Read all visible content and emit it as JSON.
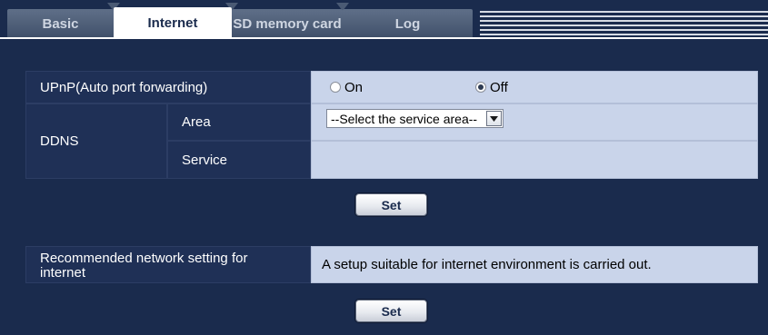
{
  "tabs": [
    {
      "label": "Basic",
      "active": false
    },
    {
      "label": "Internet",
      "active": true
    },
    {
      "label": "SD memory card",
      "active": false
    },
    {
      "label": "Log",
      "active": false
    }
  ],
  "upnp": {
    "label": "UPnP(Auto port forwarding)",
    "options": [
      {
        "label": "On",
        "checked": false
      },
      {
        "label": "Off",
        "checked": true
      }
    ]
  },
  "ddns": {
    "label": "DDNS",
    "area_label": "Area",
    "area_value": "--Select the service area--",
    "service_label": "Service",
    "service_value": ""
  },
  "set_button_1": "Set",
  "recommended": {
    "label": "Recommended network setting for internet",
    "description": "A setup suitable for internet environment is carried out."
  },
  "set_button_2": "Set",
  "colors": {
    "background": "#1a2b4d",
    "header_cell": "#1f3056",
    "value_cell": "#c9d4ea"
  }
}
